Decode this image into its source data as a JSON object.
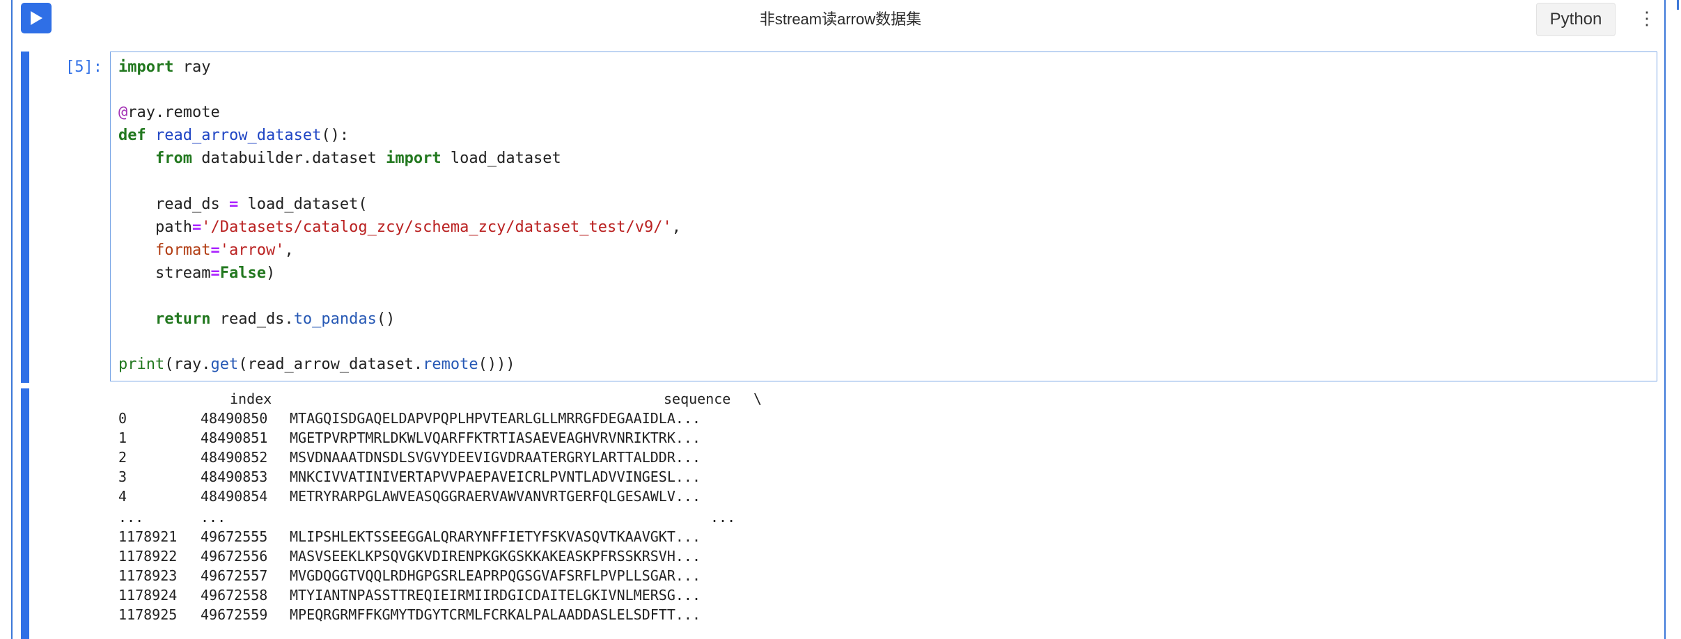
{
  "header": {
    "title": "非stream读arrow数据集",
    "kernel": "Python",
    "more_icon": "⋮"
  },
  "cell": {
    "prompt": "[5]:",
    "code": {
      "l1_import": "import",
      "l1_rest": " ray",
      "l3_at": "@",
      "l3_rest": "ray.remote",
      "l4_def": "def",
      "l4_fn": "read_arrow_dataset",
      "l4_rest": "():",
      "l5_from": "from",
      "l5_mod": " databuilder.dataset ",
      "l5_import": "import",
      "l5_name": " load_dataset",
      "l7_var": "read_ds ",
      "l7_eq": "=",
      "l7_rest": " load_dataset(",
      "l8_param": "path",
      "l8_eq": "=",
      "l8_str": "'/Datasets/catalog_zcy/schema_zcy/dataset_test/v9/'",
      "l8_comma": ",",
      "l9_param": "format",
      "l9_eq": "=",
      "l9_str": "'arrow'",
      "l9_comma": ",",
      "l10_param": "stream",
      "l10_eq": "=",
      "l10_val": "False",
      "l10_close": ")",
      "l12_return": "return",
      "l12_mid": " read_ds.",
      "l12_method": "to_pandas",
      "l12_close": "()",
      "l14_print": "print",
      "l14_a": "(ray.",
      "l14_get": "get",
      "l14_b": "(read_arrow_dataset.",
      "l14_remote": "remote",
      "l14_c": "()))"
    }
  },
  "output": {
    "header": {
      "index": "index",
      "sequence": "sequence",
      "slash": "\\"
    },
    "rows": [
      {
        "idx": "0",
        "index": "48490850",
        "sequence": "MTAGQISDGAQELDAPVPQPLHPVTEARLGLLMRRGFDEGAAIDLA..."
      },
      {
        "idx": "1",
        "index": "48490851",
        "sequence": "MGETPVRPTMRLDKWLVQARFFKTRTIASAEVEAGHVRVNRIKTRK..."
      },
      {
        "idx": "2",
        "index": "48490852",
        "sequence": "MSVDNAAATDNSDLSVGVYDEEVIGVDRAATERGRYLARTTALDDR..."
      },
      {
        "idx": "3",
        "index": "48490853",
        "sequence": "MNKCIVVATINIVERTAPVVPAEPAVEICRLPVNTLADVVINGESL..."
      },
      {
        "idx": "4",
        "index": "48490854",
        "sequence": "METRYRARPGLAWVEASQGGRAERVAWVANVRTGERFQLGESAWLV..."
      },
      {
        "idx": "1178921",
        "index": "49672555",
        "sequence": "MLIPSHLEKTSSEEGGALQRARYNFFIETYFSKVASQVTKAAVGKT..."
      },
      {
        "idx": "1178922",
        "index": "49672556",
        "sequence": "MASVSEEKLKPSQVGKVDIRENPKGKGSKKAKEASKPFRSSKRSVH..."
      },
      {
        "idx": "1178923",
        "index": "49672557",
        "sequence": "MVGDQGGTVQQLRDHGPGSRLEAPRPQGSGVAFSRFLPVPLLSGAR..."
      },
      {
        "idx": "1178924",
        "index": "49672558",
        "sequence": "MTYIANTNPASSTTREQIEIRMIIRDGICDAITELGKIVNLMERSG..."
      },
      {
        "idx": "1178925",
        "index": "49672559",
        "sequence": "MPEQRGRMFFKGMYTDGYTCRMLFCRKALPALAADDASLELSDFTT..."
      }
    ],
    "ellipsis": {
      "idx": "...",
      "index": "...",
      "sequence": "..."
    }
  },
  "colors": {
    "accent": "#2f6fe6",
    "editor_border": "#7aa6e6"
  }
}
